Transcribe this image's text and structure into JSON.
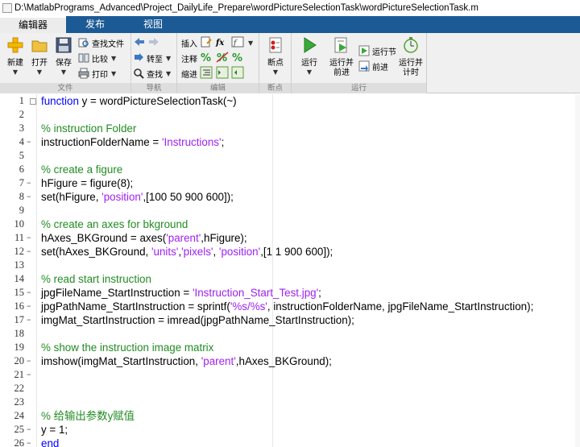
{
  "window": {
    "title": "D:\\MatlabPrograms_Advanced\\Project_DailyLife_Prepare\\wordPictureSelectionTask\\wordPictureSelectionTask.m"
  },
  "tabs": [
    {
      "label": "编辑器",
      "active": true
    },
    {
      "label": "发布",
      "active": false
    },
    {
      "label": "视图",
      "active": false
    }
  ],
  "ribbon": {
    "file": {
      "group_label": "文件",
      "new_label": "新建",
      "open_label": "打开",
      "save_label": "保存",
      "find_files_label": "查找文件",
      "compare_label": "比较",
      "print_label": "打印"
    },
    "navigate": {
      "group_label": "导航",
      "goto_label": "转至",
      "find_label": "查找"
    },
    "edit": {
      "group_label": "编辑",
      "insert_label": "插入",
      "comment_label": "注释",
      "indent_label": "缩进",
      "fx_label": "fx"
    },
    "breakpoints": {
      "group_label": "断点",
      "breakpoints_label": "断点"
    },
    "run": {
      "group_label": "运行",
      "run_label": "运行",
      "run_advance_label": "运行并\n前进",
      "run_section_label": "运行节",
      "advance_label": "前进",
      "run_time_label": "运行并\n计时"
    }
  },
  "colors": {
    "tab_bar": "#1b5a95",
    "keyword": "#0000ff",
    "comment": "#228b22",
    "string": "#a020f0"
  },
  "code": {
    "lines": [
      {
        "n": "1",
        "dash": false,
        "parts": [
          [
            "kw",
            "function"
          ],
          [
            "",
            " y = wordPictureSelectionTask(~)"
          ]
        ]
      },
      {
        "n": "2",
        "dash": false,
        "parts": []
      },
      {
        "n": "3",
        "dash": false,
        "parts": [
          [
            "cm",
            "% instruction Folder"
          ]
        ]
      },
      {
        "n": "4",
        "dash": true,
        "parts": [
          [
            "",
            "instructionFolderName = "
          ],
          [
            "st",
            "'Instructions'"
          ],
          [
            "",
            ";"
          ]
        ]
      },
      {
        "n": "5",
        "dash": false,
        "parts": []
      },
      {
        "n": "6",
        "dash": false,
        "parts": [
          [
            "cm",
            "% create a figure"
          ]
        ]
      },
      {
        "n": "7",
        "dash": true,
        "parts": [
          [
            "",
            "hFigure = figure(8);"
          ]
        ]
      },
      {
        "n": "8",
        "dash": true,
        "parts": [
          [
            "",
            "set(hFigure, "
          ],
          [
            "st",
            "'position'"
          ],
          [
            "",
            ",[100 50 900 600]);"
          ]
        ]
      },
      {
        "n": "9",
        "dash": false,
        "parts": []
      },
      {
        "n": "10",
        "dash": false,
        "parts": [
          [
            "cm",
            "% create an axes for bkground"
          ]
        ]
      },
      {
        "n": "11",
        "dash": true,
        "parts": [
          [
            "",
            "hAxes_BKGround = axes("
          ],
          [
            "st",
            "'parent'"
          ],
          [
            "",
            ",hFigure);"
          ]
        ]
      },
      {
        "n": "12",
        "dash": true,
        "parts": [
          [
            "",
            "set(hAxes_BKGround, "
          ],
          [
            "st",
            "'units'"
          ],
          [
            "",
            ","
          ],
          [
            "st",
            "'pixels'"
          ],
          [
            "",
            ", "
          ],
          [
            "st",
            "'position'"
          ],
          [
            "",
            ",[1 1 900 600]);"
          ]
        ]
      },
      {
        "n": "13",
        "dash": false,
        "parts": []
      },
      {
        "n": "14",
        "dash": false,
        "parts": [
          [
            "cm",
            "% read start instruction"
          ]
        ]
      },
      {
        "n": "15",
        "dash": true,
        "parts": [
          [
            "",
            "jpgFileName_StartInstruction = "
          ],
          [
            "st",
            "'Instruction_Start_Test.jpg'"
          ],
          [
            "",
            ";"
          ]
        ]
      },
      {
        "n": "16",
        "dash": true,
        "parts": [
          [
            "",
            "jpgPathName_StartInstruction = sprintf("
          ],
          [
            "st",
            "'%s/%s'"
          ],
          [
            "",
            ", instructionFolderName, jpgFileName_StartInstruction);"
          ]
        ]
      },
      {
        "n": "17",
        "dash": true,
        "parts": [
          [
            "",
            "imgMat_StartInstruction = imread(jpgPathName_StartInstruction);"
          ]
        ]
      },
      {
        "n": "18",
        "dash": false,
        "parts": []
      },
      {
        "n": "19",
        "dash": false,
        "parts": [
          [
            "cm",
            "% show the instruction image matrix"
          ]
        ]
      },
      {
        "n": "20",
        "dash": true,
        "parts": [
          [
            "",
            "imshow(imgMat_StartInstruction, "
          ],
          [
            "st",
            "'parent'"
          ],
          [
            "",
            ",hAxes_BKGround);"
          ]
        ]
      },
      {
        "n": "21",
        "dash": true,
        "parts": []
      },
      {
        "n": "22",
        "dash": false,
        "parts": []
      },
      {
        "n": "23",
        "dash": false,
        "parts": []
      },
      {
        "n": "24",
        "dash": false,
        "parts": [
          [
            "cm",
            "% 给输出参数y赋值"
          ]
        ]
      },
      {
        "n": "25",
        "dash": true,
        "parts": [
          [
            "",
            "y = 1;"
          ]
        ]
      },
      {
        "n": "26",
        "dash": true,
        "parts": [
          [
            "kw",
            "end"
          ]
        ]
      }
    ]
  }
}
